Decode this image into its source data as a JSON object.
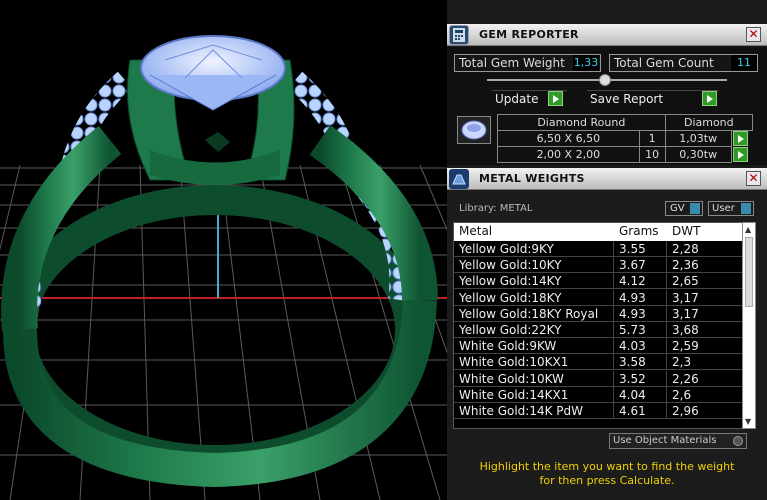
{
  "gem_reporter": {
    "title": "GEM REPORTER",
    "total_weight_label": "Total Gem Weight",
    "total_weight_value": "1,33",
    "total_count_label": "Total Gem Count",
    "total_count_value": "11",
    "update_label": "Update",
    "save_label": "Save Report",
    "table_header_shape": "Diamond Round",
    "table_header_material": "Diamond",
    "rows": [
      {
        "size": "6,50 X 6,50",
        "count": "1",
        "weight": "1,03tw"
      },
      {
        "size": "2,00 X 2,00",
        "count": "10",
        "weight": "0,30tw"
      }
    ]
  },
  "metal_weights": {
    "title": "METAL WEIGHTS",
    "library_label": "Library: METAL",
    "gv_label": "GV",
    "user_label": "User",
    "columns": [
      "Metal",
      "Grams",
      "DWT"
    ],
    "rows": [
      {
        "metal": "Yellow Gold:9KY",
        "grams": "3.55",
        "dwt": "2,28"
      },
      {
        "metal": "Yellow Gold:10KY",
        "grams": "3.67",
        "dwt": "2,36"
      },
      {
        "metal": "Yellow Gold:14KY",
        "grams": "4.12",
        "dwt": "2,65"
      },
      {
        "metal": "Yellow Gold:18KY",
        "grams": "4.93",
        "dwt": "3,17"
      },
      {
        "metal": "Yellow Gold:18KY Royal",
        "grams": "4.93",
        "dwt": "3,17"
      },
      {
        "metal": "Yellow Gold:22KY",
        "grams": "5.73",
        "dwt": "3,68"
      },
      {
        "metal": "White Gold:9KW",
        "grams": "4.03",
        "dwt": "2,59"
      },
      {
        "metal": "White Gold:10KX1",
        "grams": "3.58",
        "dwt": "2,3"
      },
      {
        "metal": "White Gold:10KW",
        "grams": "3.52",
        "dwt": "2,26"
      },
      {
        "metal": "White Gold:14KX1",
        "grams": "4.04",
        "dwt": "2,6"
      },
      {
        "metal": "White Gold:14K PdW",
        "grams": "4.61",
        "dwt": "2,96"
      }
    ],
    "use_object_materials_label": "Use Object Materials",
    "hint_line1": "Highlight the item you want to find the weight",
    "hint_line2": "for then press Calculate."
  },
  "colors": {
    "ring_green": "#1e7a4a",
    "gem_blue": "#a8c6ff",
    "hint_yellow": "#f0d000",
    "value_cyan": "#3ad0e8"
  }
}
